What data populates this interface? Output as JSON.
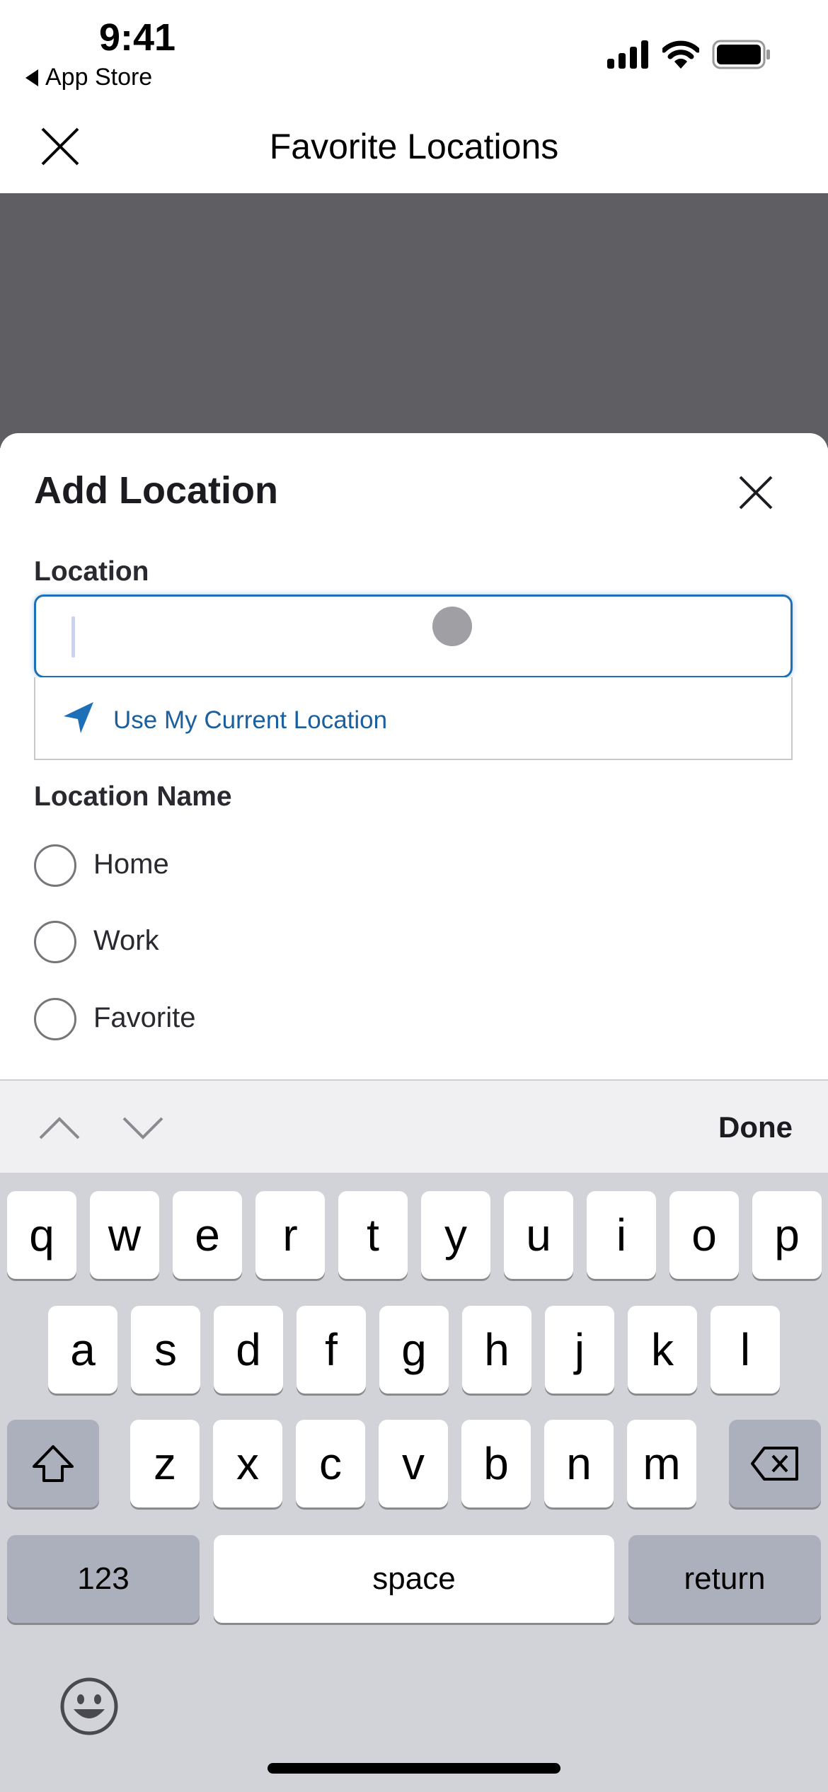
{
  "status_bar": {
    "time": "9:41",
    "back_label": "App Store",
    "icons": [
      "signal-icon",
      "wifi-icon",
      "battery-icon"
    ]
  },
  "nav": {
    "title": "Favorite Locations",
    "close_icon": "close-icon"
  },
  "sheet": {
    "title": "Add Location",
    "location_label": "Location",
    "location_value": "",
    "suggestion": "Use My Current Location",
    "name_label": "Location Name",
    "options": [
      {
        "label": "Home",
        "selected": false
      },
      {
        "label": "Work",
        "selected": false
      },
      {
        "label": "Favorite",
        "selected": false
      }
    ]
  },
  "toolbar": {
    "done": "Done"
  },
  "keyboard": {
    "row1": [
      "q",
      "w",
      "e",
      "r",
      "t",
      "y",
      "u",
      "i",
      "o",
      "p"
    ],
    "row2": [
      "a",
      "s",
      "d",
      "f",
      "g",
      "h",
      "j",
      "k",
      "l"
    ],
    "row3": [
      "z",
      "x",
      "c",
      "v",
      "b",
      "n",
      "m"
    ],
    "numbers": "123",
    "space": "space",
    "return": "return"
  },
  "colors": {
    "accent": "#1d70b8",
    "link": "#1b5f9e",
    "overlay": "#5f5e62",
    "keyboard": "#d1d3d9"
  }
}
